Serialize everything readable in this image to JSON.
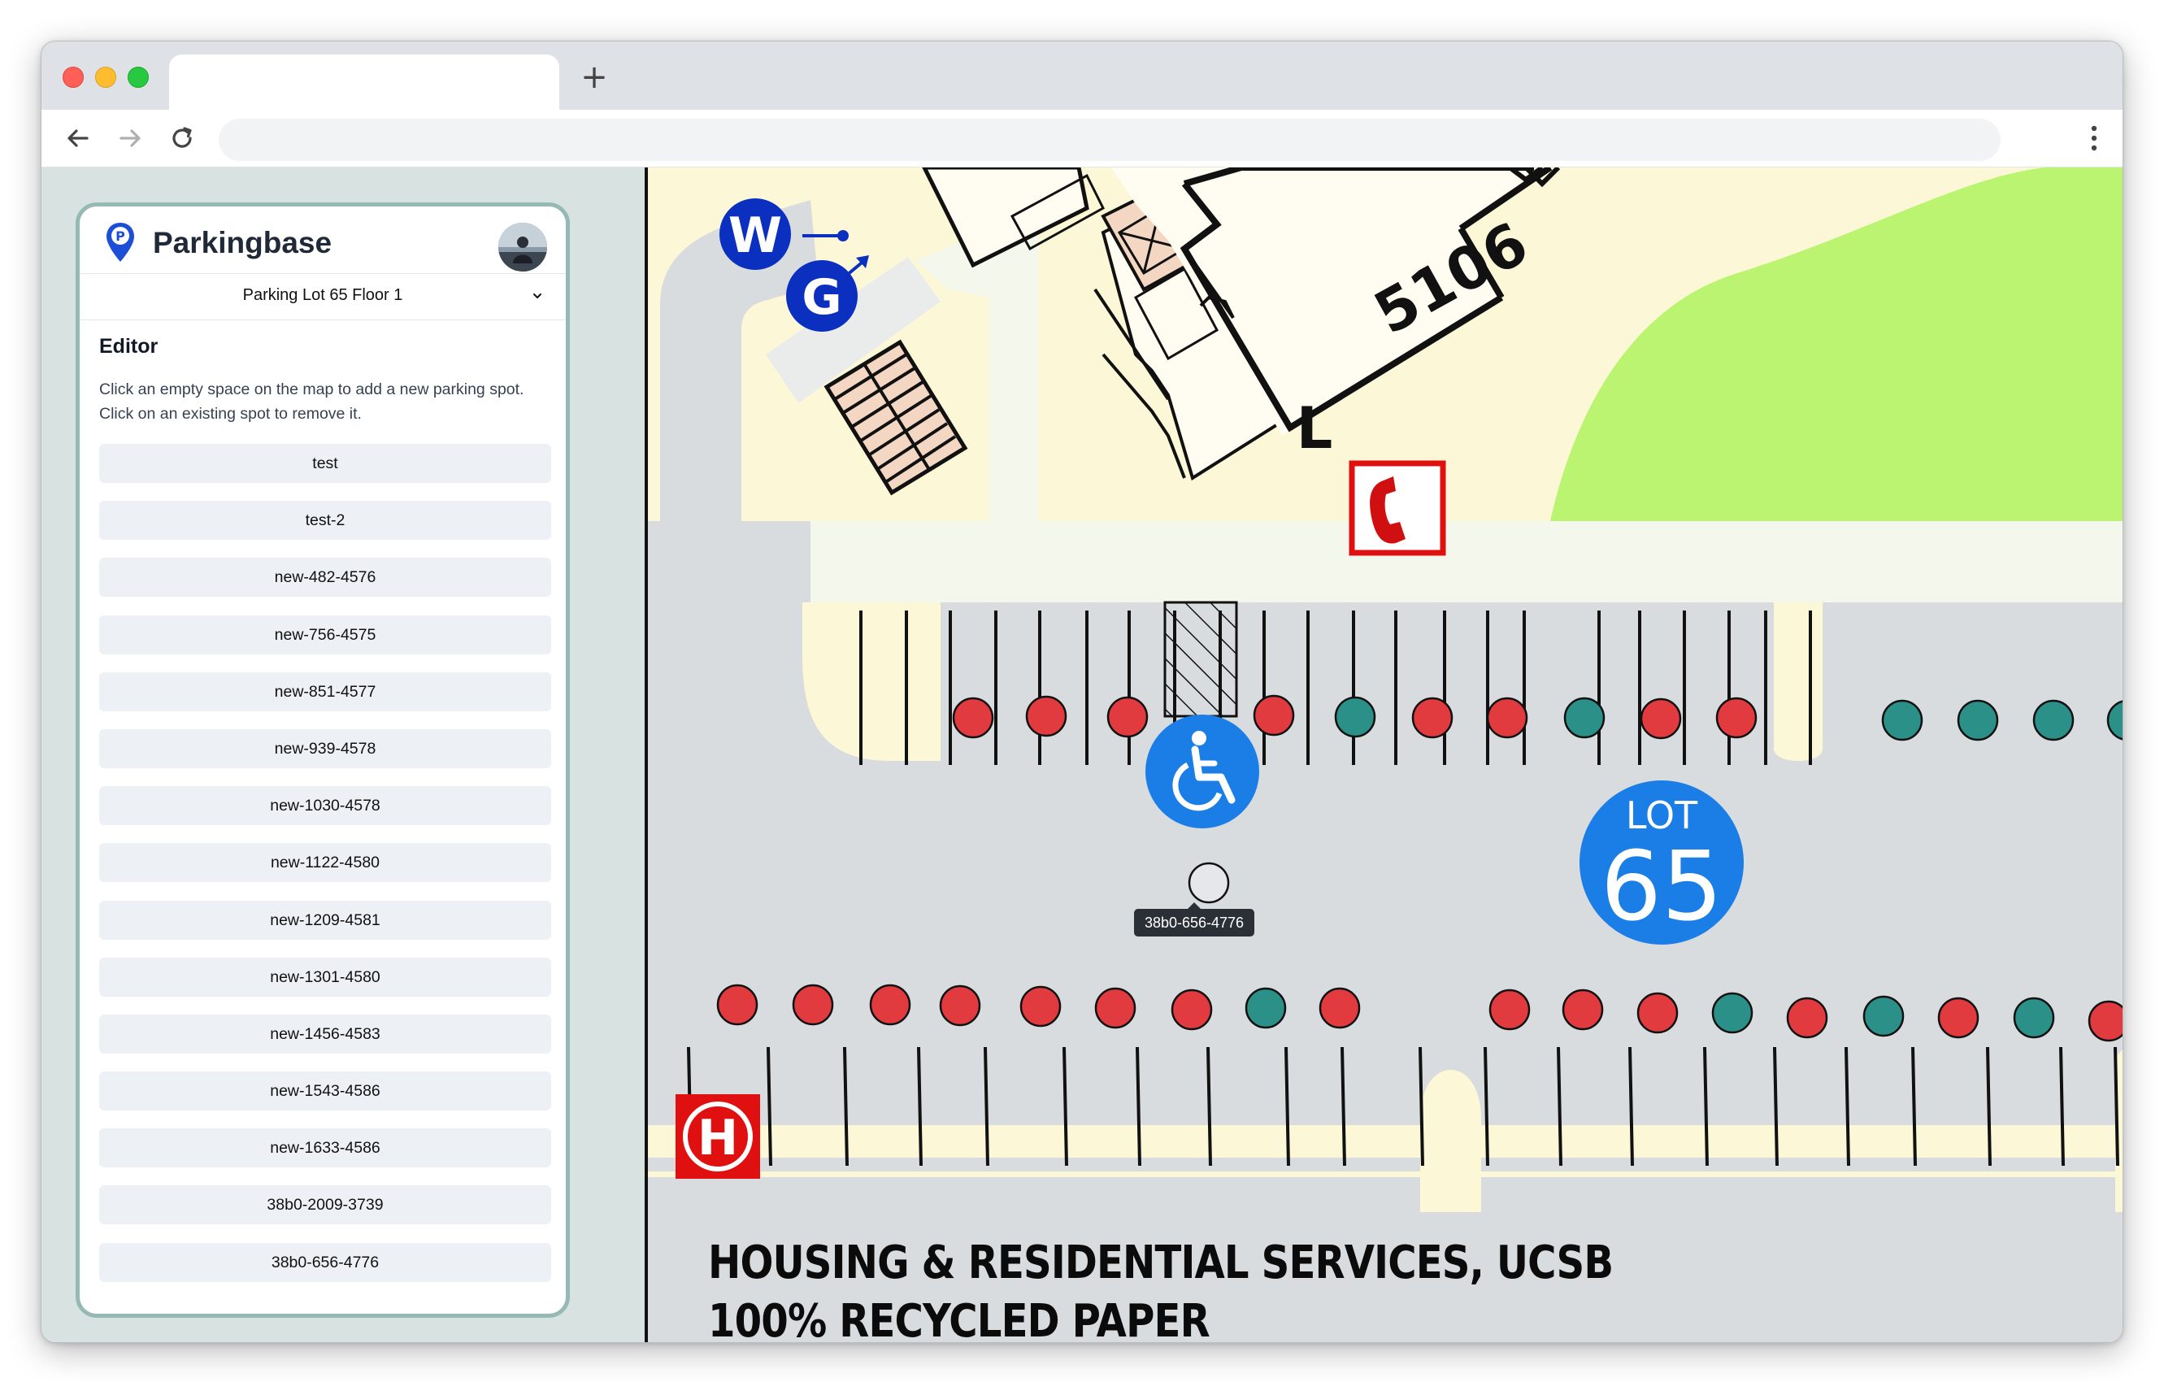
{
  "browser": {
    "tab_title": "",
    "url": ""
  },
  "app": {
    "brand": "Parkingbase",
    "lot_selector": "Parking Lot 65 Floor 1",
    "editor_title": "Editor",
    "editor_description": "Click an empty space on the map to add a new parking spot. Click on an existing spot to remove it."
  },
  "spots": [
    {
      "label": "test"
    },
    {
      "label": "test-2"
    },
    {
      "label": "new-482-4576"
    },
    {
      "label": "new-756-4575"
    },
    {
      "label": "new-851-4577"
    },
    {
      "label": "new-939-4578"
    },
    {
      "label": "new-1030-4578"
    },
    {
      "label": "new-1122-4580"
    },
    {
      "label": "new-1209-4581"
    },
    {
      "label": "new-1301-4580"
    },
    {
      "label": "new-1456-4583"
    },
    {
      "label": "new-1543-4586"
    },
    {
      "label": "new-1633-4586"
    },
    {
      "label": "38b0-2009-3739"
    },
    {
      "label": "38b0-656-4776"
    }
  ],
  "map": {
    "building_number": "5106",
    "building_marker": "L",
    "restroom_women": "W",
    "restroom_gender_neutral": "G",
    "lot_badge_top": "LOT",
    "lot_badge_number": "65",
    "hovered_spot_tooltip": "38b0-656-4776",
    "hospital_letter": "H",
    "footer_line1": "HOUSING & RESIDENTIAL SERVICES, UCSB",
    "footer_line2": "100% RECYCLED PAPER",
    "colors": {
      "occupied": "#e23b3f",
      "available": "#2a9088",
      "selected": "#e5e7eb",
      "badge_blue": "#1a7ee6",
      "restroom_blue": "#0b2fbf"
    }
  }
}
